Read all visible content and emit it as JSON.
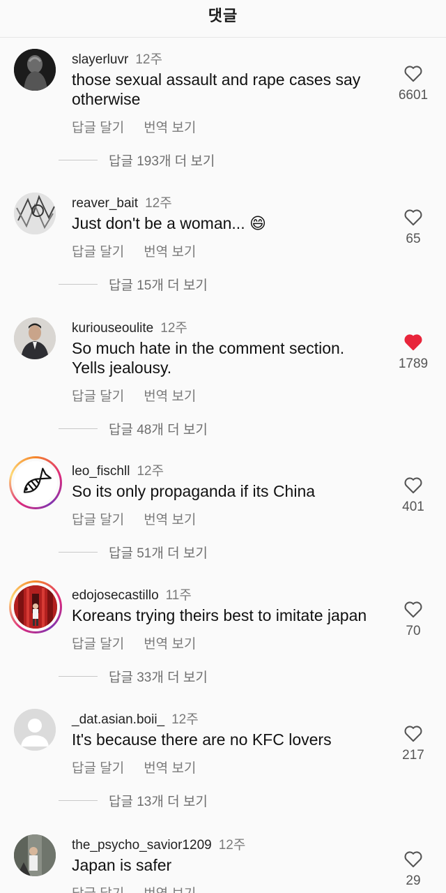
{
  "header": {
    "title": "댓글"
  },
  "ui": {
    "reply_label": "답글 달기",
    "translate_label": "번역 보기"
  },
  "comments": [
    {
      "username": "slayerluvr",
      "time": "12주",
      "text_lines": [
        "those sexual assault and rape cases say",
        "otherwise"
      ],
      "likes": "6601",
      "liked": false,
      "more_replies": "답글 193개 더 보기",
      "avatar": "dark-figure"
    },
    {
      "username": "reaver_bait",
      "time": "12주",
      "text_lines": [
        "Just don't be a woman... 😄"
      ],
      "likes": "65",
      "liked": false,
      "more_replies": "답글 15개 더 보기",
      "avatar": "manga-sketch"
    },
    {
      "username": "kuriouseoulite",
      "time": "12주",
      "text_lines": [
        "So much hate in the comment section.",
        "Yells jealousy."
      ],
      "likes": "1789",
      "liked": true,
      "more_replies": "답글 48개 더 보기",
      "avatar": "man-in-suit"
    },
    {
      "username": "leo_fischll",
      "time": "12주",
      "text_lines": [
        "So its only propaganda if its China"
      ],
      "likes": "401",
      "liked": false,
      "more_replies": "답글 51개 더 보기",
      "avatar": "fish-icon"
    },
    {
      "username": "edojosecastillo",
      "time": "11주",
      "text_lines": [
        "Koreans trying theirs best to imitate japan"
      ],
      "likes": "70",
      "liked": false,
      "more_replies": "답글 33개 더 보기",
      "avatar": "red-gate"
    },
    {
      "username": "_dat.asian.boii_",
      "time": "12주",
      "text_lines": [
        "It's because there are no KFC lovers"
      ],
      "likes": "217",
      "liked": false,
      "more_replies": "답글 13개 더 보기",
      "avatar": "default-person"
    },
    {
      "username": "the_psycho_savior1209",
      "time": "12주",
      "text_lines": [
        "Japan is safer"
      ],
      "likes": "29",
      "liked": false,
      "more_replies": "",
      "avatar": "street-photo"
    }
  ],
  "colors": {
    "liked": "#e8253b",
    "muted_text": "#7a7a7a"
  }
}
